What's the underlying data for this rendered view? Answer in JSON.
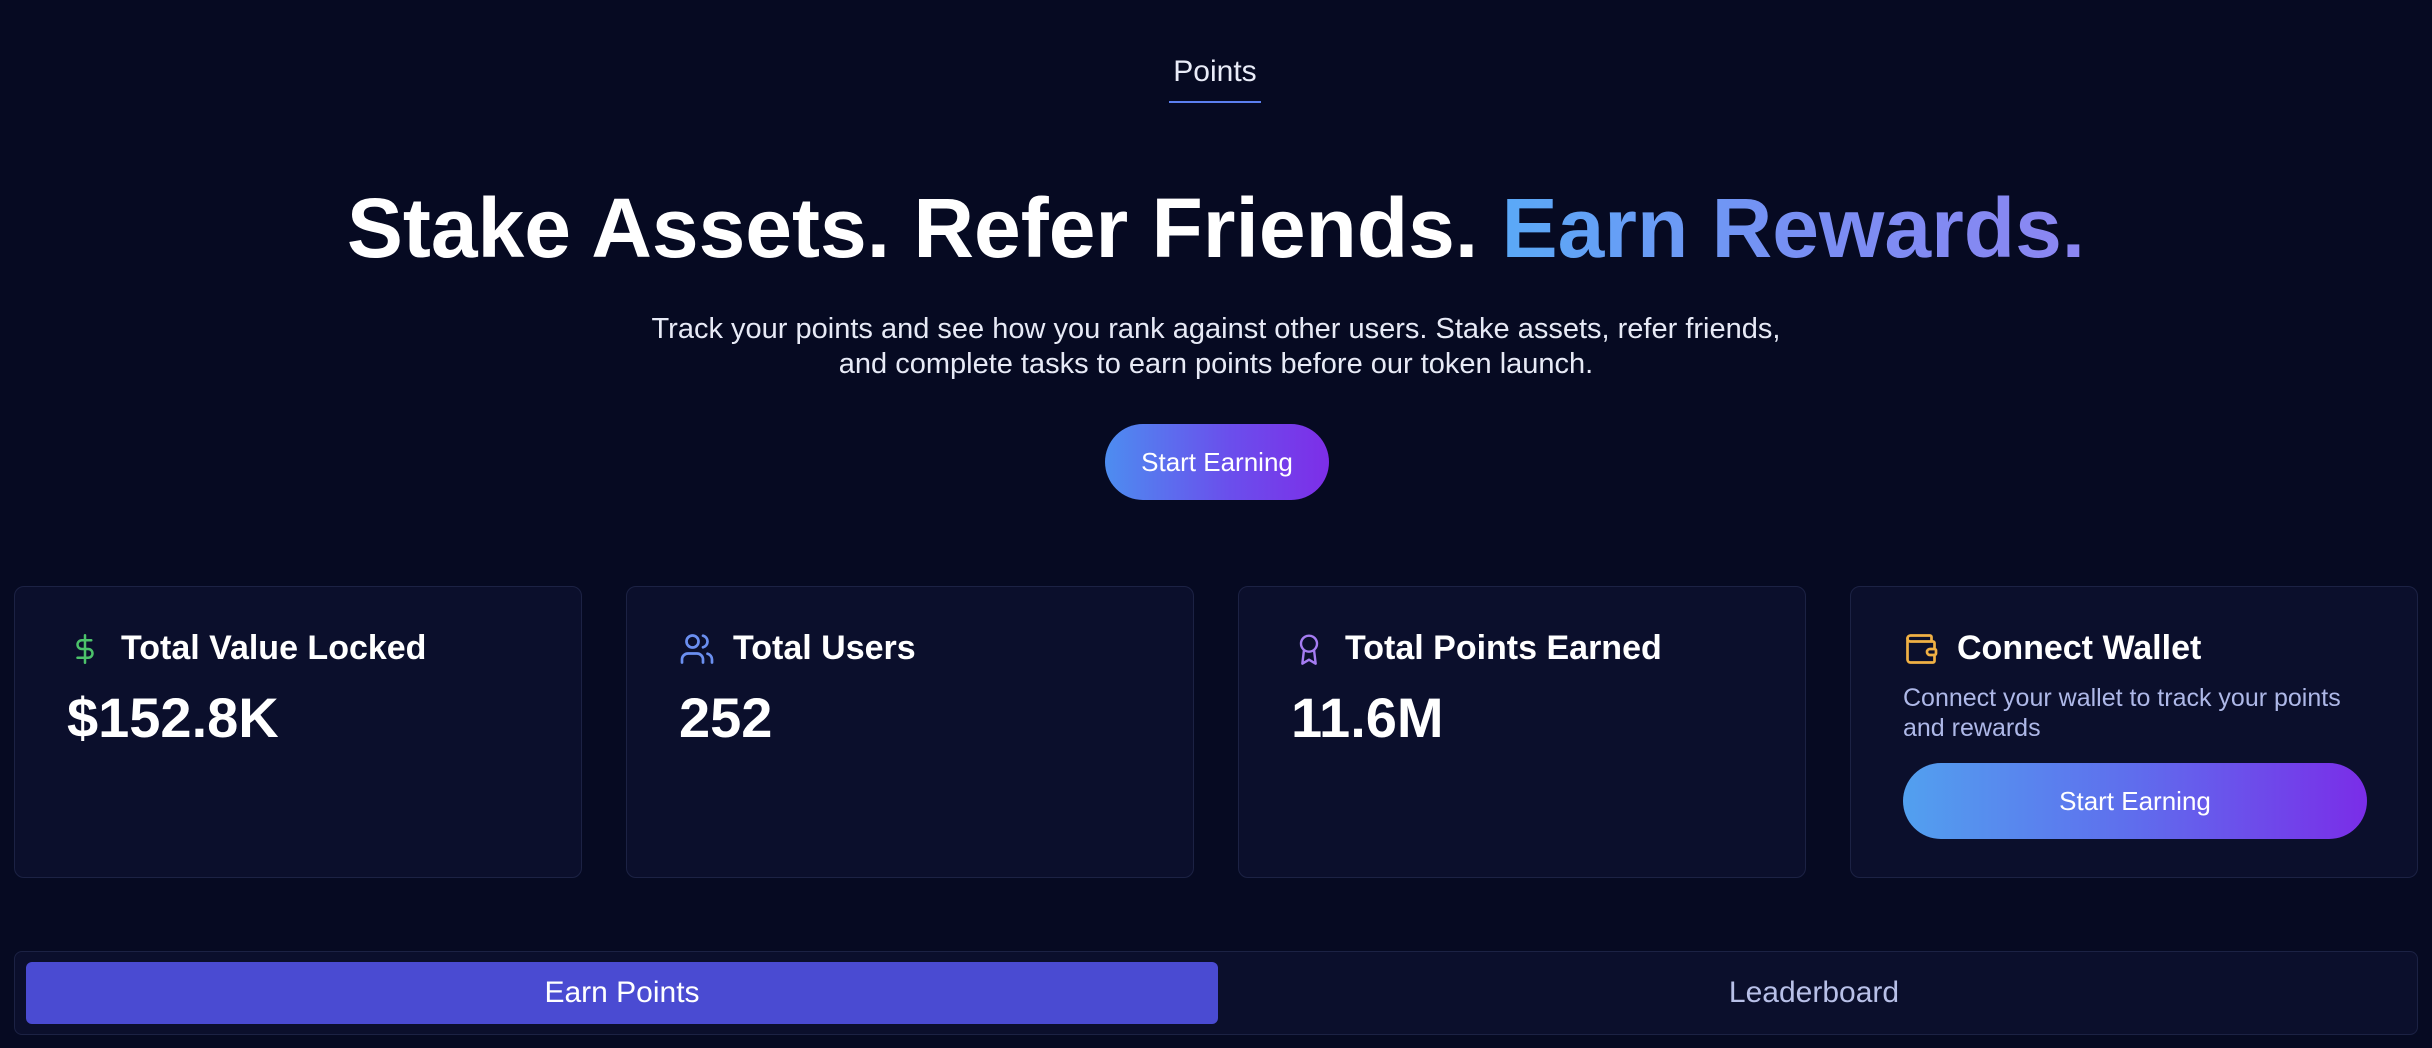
{
  "nav": {
    "tab_label": "Points"
  },
  "hero": {
    "title_main": "Stake Assets. Refer Friends.",
    "title_accent": "Earn Rewards.",
    "subtitle_line1": "Track your points and see how you rank against other users. Stake assets, refer friends,",
    "subtitle_line2": "and complete tasks to earn points before our token launch.",
    "cta_label": "Start Earning"
  },
  "stats": [
    {
      "title": "Total Value Locked",
      "value": "$152.8K",
      "icon": "dollar-icon",
      "icon_color": "#4cc26a"
    },
    {
      "title": "Total Users",
      "value": "252",
      "icon": "users-icon",
      "icon_color": "#6b8ff0"
    },
    {
      "title": "Total Points Earned",
      "value": "11.6M",
      "icon": "award-icon",
      "icon_color": "#a57cf2"
    }
  ],
  "wallet": {
    "title": "Connect Wallet",
    "icon": "wallet-icon",
    "icon_color": "#f0b044",
    "description": "Connect your wallet to track your points and rewards",
    "button_label": "Start Earning"
  },
  "tabs": [
    {
      "label": "Earn Points",
      "active": true
    },
    {
      "label": "Leaderboard",
      "active": false
    }
  ],
  "colors": {
    "background": "#060a22",
    "card": "#0b0f2c",
    "accent_gradient_start": "#5aa9f7",
    "accent_gradient_end": "#7d2ee8",
    "active_tab": "#4a4bd2"
  }
}
